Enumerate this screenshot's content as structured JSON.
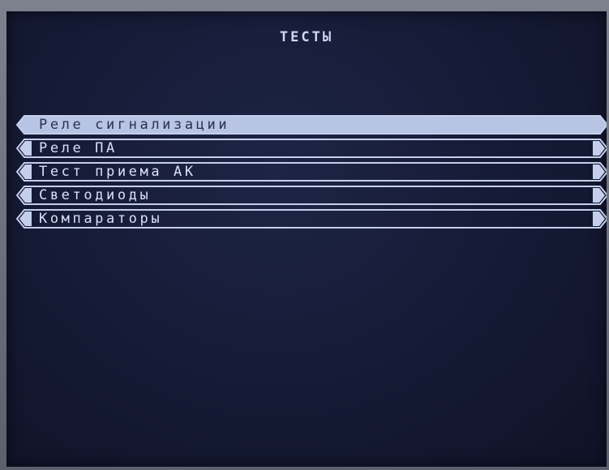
{
  "screen": {
    "title": "ТЕСТЫ"
  },
  "menu": {
    "selected_index": 0,
    "items": [
      {
        "label": "Реле сигнализации"
      },
      {
        "label": "Реле ПА"
      },
      {
        "label": "Тест приема АК"
      },
      {
        "label": "Светодиоды"
      },
      {
        "label": "Компараторы"
      }
    ]
  },
  "colors": {
    "background": "#151a34",
    "text": "#d8e1f7",
    "selection": "#b7c4e4",
    "frame": "#c4cfec"
  }
}
